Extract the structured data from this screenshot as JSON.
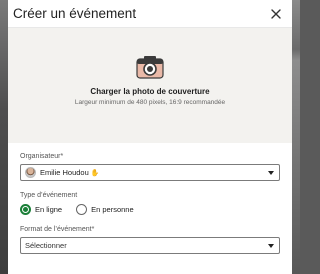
{
  "modal": {
    "title": "Créer un événement"
  },
  "cover": {
    "title": "Charger la photo de couverture",
    "subtitle": "Largeur minimum de 480 pixels, 16:9 recommandée"
  },
  "organizer": {
    "label": "Organisateur*",
    "value": "Emilie Houdou",
    "badge": "✋"
  },
  "event_type": {
    "label": "Type d’événement",
    "options": [
      {
        "label": "En ligne",
        "selected": true
      },
      {
        "label": "En personne",
        "selected": false
      }
    ]
  },
  "event_format": {
    "label": "Format de l’événement*",
    "value": "Sélectionner"
  },
  "colors": {
    "accent_green": "#1a7f37",
    "cover_bg": "#f3f2ef"
  }
}
